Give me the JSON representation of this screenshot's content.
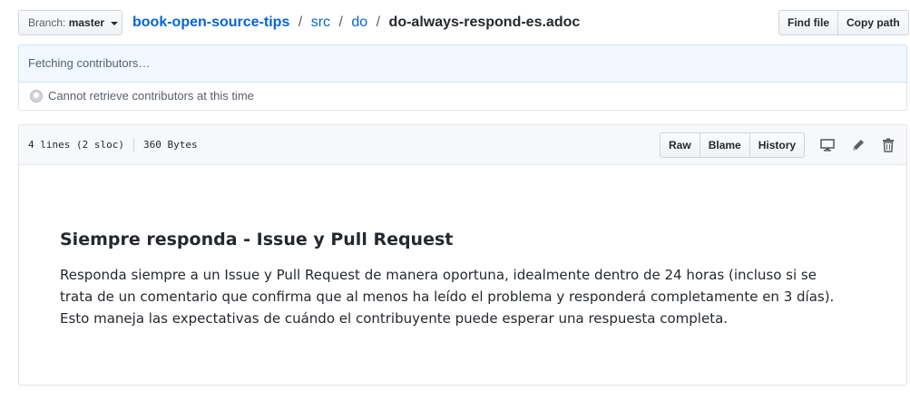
{
  "branch": {
    "label": "Branch:",
    "name": "master"
  },
  "breadcrumb": {
    "repo": "book-open-source-tips",
    "sep1": "/",
    "dir1": "src",
    "sep2": "/",
    "dir2": "do",
    "sep3": "/",
    "file": "do-always-respond-es.adoc"
  },
  "actions": {
    "find_file": "Find file",
    "copy_path": "Copy path"
  },
  "contributors": {
    "fetching": "Fetching contributors…",
    "error": "Cannot retrieve contributors at this time"
  },
  "file": {
    "lines": "4 lines (2 sloc)",
    "size": "360 Bytes",
    "buttons": {
      "raw": "Raw",
      "blame": "Blame",
      "history": "History"
    },
    "icons": [
      "desktop-icon",
      "pencil-icon",
      "trash-icon"
    ]
  },
  "content": {
    "heading": "Siempre responda - Issue y Pull Request",
    "paragraph": "Responda siempre a un Issue y Pull Request de manera oportuna, idealmente dentro de 24 horas (incluso si se trata de un comentario que confirma que al menos ha leído el problema y responderá completamente en 3 días). Esto maneja las expectativas de cuándo el contribuyente puede esperar una respuesta completa."
  },
  "colors": {
    "link": "#0366d6",
    "text": "#24292e",
    "muted": "#586069",
    "info_bg": "#f1f8ff",
    "border": "#e1e4e8"
  }
}
